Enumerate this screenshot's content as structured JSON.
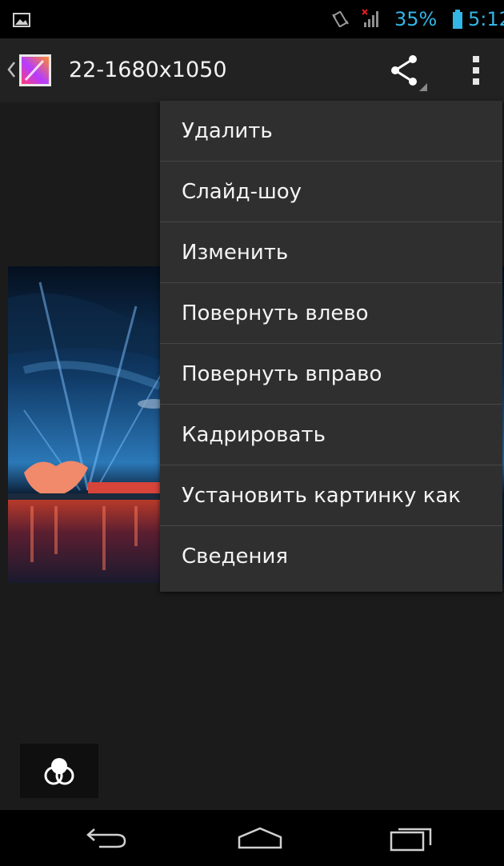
{
  "status_bar": {
    "battery_percent": "35%",
    "time": "5:12",
    "icons": [
      "gallery-notification-icon",
      "vibrate-icon",
      "signal-no-sim-icon",
      "battery-icon"
    ],
    "accent_color": "#33b5e5"
  },
  "action_bar": {
    "title": "22-1680x1050",
    "icons": [
      "up-chevron-icon",
      "app-thumbnail-icon",
      "share-icon",
      "overflow-menu-icon"
    ]
  },
  "menu": {
    "items": [
      "Удалить",
      "Слайд-шоу",
      "Изменить",
      "Повернуть влево",
      "Повернуть вправо",
      "Кадрировать",
      "Установить картинку как",
      "Сведения"
    ]
  },
  "bottom": {
    "icons": [
      "filter-effects-icon"
    ]
  },
  "nav_bar": {
    "icons": [
      "back-icon",
      "home-icon",
      "recent-apps-icon"
    ]
  }
}
